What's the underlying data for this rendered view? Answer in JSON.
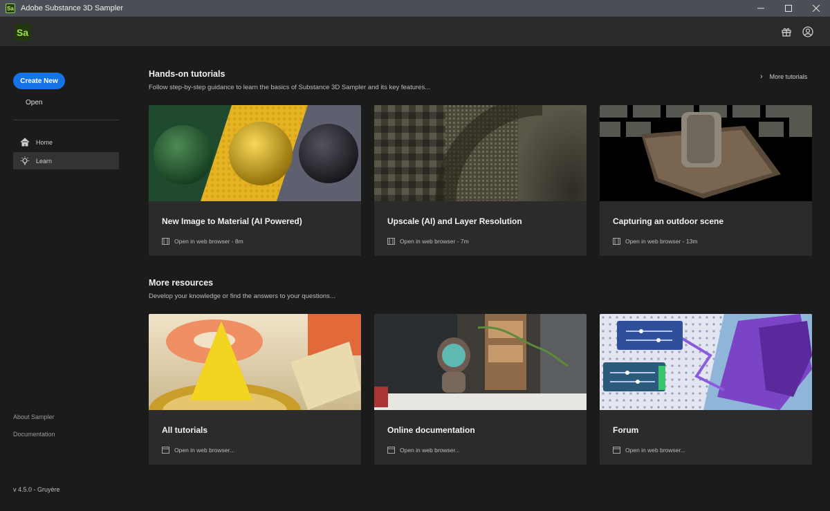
{
  "window": {
    "title": "Adobe Substance 3D Sampler",
    "app_icon_text": "Sa"
  },
  "header": {
    "logo_text": "Sa"
  },
  "sidebar": {
    "create_label": "Create New",
    "open_label": "Open",
    "nav": [
      {
        "label": "Home",
        "icon": "home-icon"
      },
      {
        "label": "Learn",
        "icon": "lightbulb-icon",
        "active": true
      }
    ],
    "about_label": "About Sampler",
    "docs_label": "Documentation",
    "version": "v 4.5.0 - Gruyère"
  },
  "tutorials": {
    "title": "Hands-on tutorials",
    "subtitle": "Follow step-by-step guidance to learn the basics of Substance 3D Sampler and its key features...",
    "more_label": "More tutorials",
    "cards": [
      {
        "title": "New Image to Material (AI Powered)",
        "meta": "Open in web browser - 8m"
      },
      {
        "title": "Upscale (AI) and Layer Resolution",
        "meta": "Open in web browser - 7m"
      },
      {
        "title": "Capturing an outdoor scene",
        "meta": "Open in web browser - 13m"
      }
    ]
  },
  "resources": {
    "title": "More resources",
    "subtitle": "Develop your knowledge or find the answers to your questions...",
    "cards": [
      {
        "title": "All tutorials",
        "meta": "Open in web browser..."
      },
      {
        "title": "Online documentation",
        "meta": "Open in web browser..."
      },
      {
        "title": "Forum",
        "meta": "Open in web browser..."
      }
    ]
  },
  "colors": {
    "accent": "#1473e6",
    "brand_green": "#9fe14e",
    "background": "#1b1b1b",
    "card": "#2b2b2b"
  }
}
